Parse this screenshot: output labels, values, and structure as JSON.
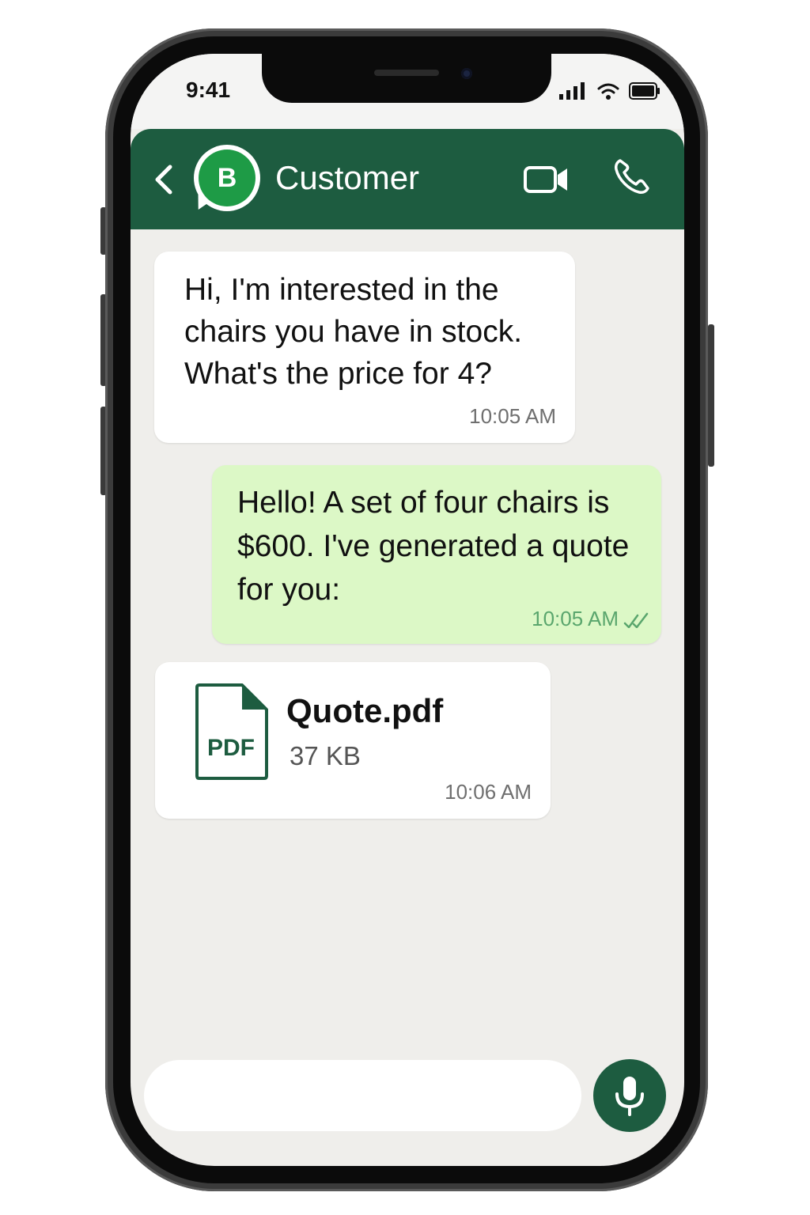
{
  "status_bar": {
    "time": "9:41",
    "icons": [
      "signal-icon",
      "wifi-icon",
      "battery-icon"
    ]
  },
  "header": {
    "contact_name": "Customer",
    "avatar_letter": "B",
    "back_icon": "chevron-left-icon",
    "video_icon": "video-call-icon",
    "call_icon": "phone-icon"
  },
  "messages": [
    {
      "direction": "incoming",
      "text": "Hi, I'm interested in the chairs you have in stock. What's the price for 4?",
      "time": "10:05 AM"
    },
    {
      "direction": "outgoing",
      "text": "Hello! A set of four chairs is $600. I've generated a quote for you:",
      "time": "10:05 AM",
      "status_icon": "double-check-icon"
    },
    {
      "direction": "incoming",
      "type": "file",
      "file_icon_label": "PDF",
      "file_name": "Quote.pdf",
      "file_size": "37 KB",
      "time": "10:06 AM"
    }
  ],
  "composer": {
    "placeholder": "",
    "mic_icon": "microphone-icon"
  },
  "colors": {
    "header": "#1d5c40",
    "outgoing_bubble": "#dcf8c6",
    "chat_background": "#efeeeb",
    "avatar": "#1e9b46",
    "read_ticks": "#5aa66d"
  }
}
